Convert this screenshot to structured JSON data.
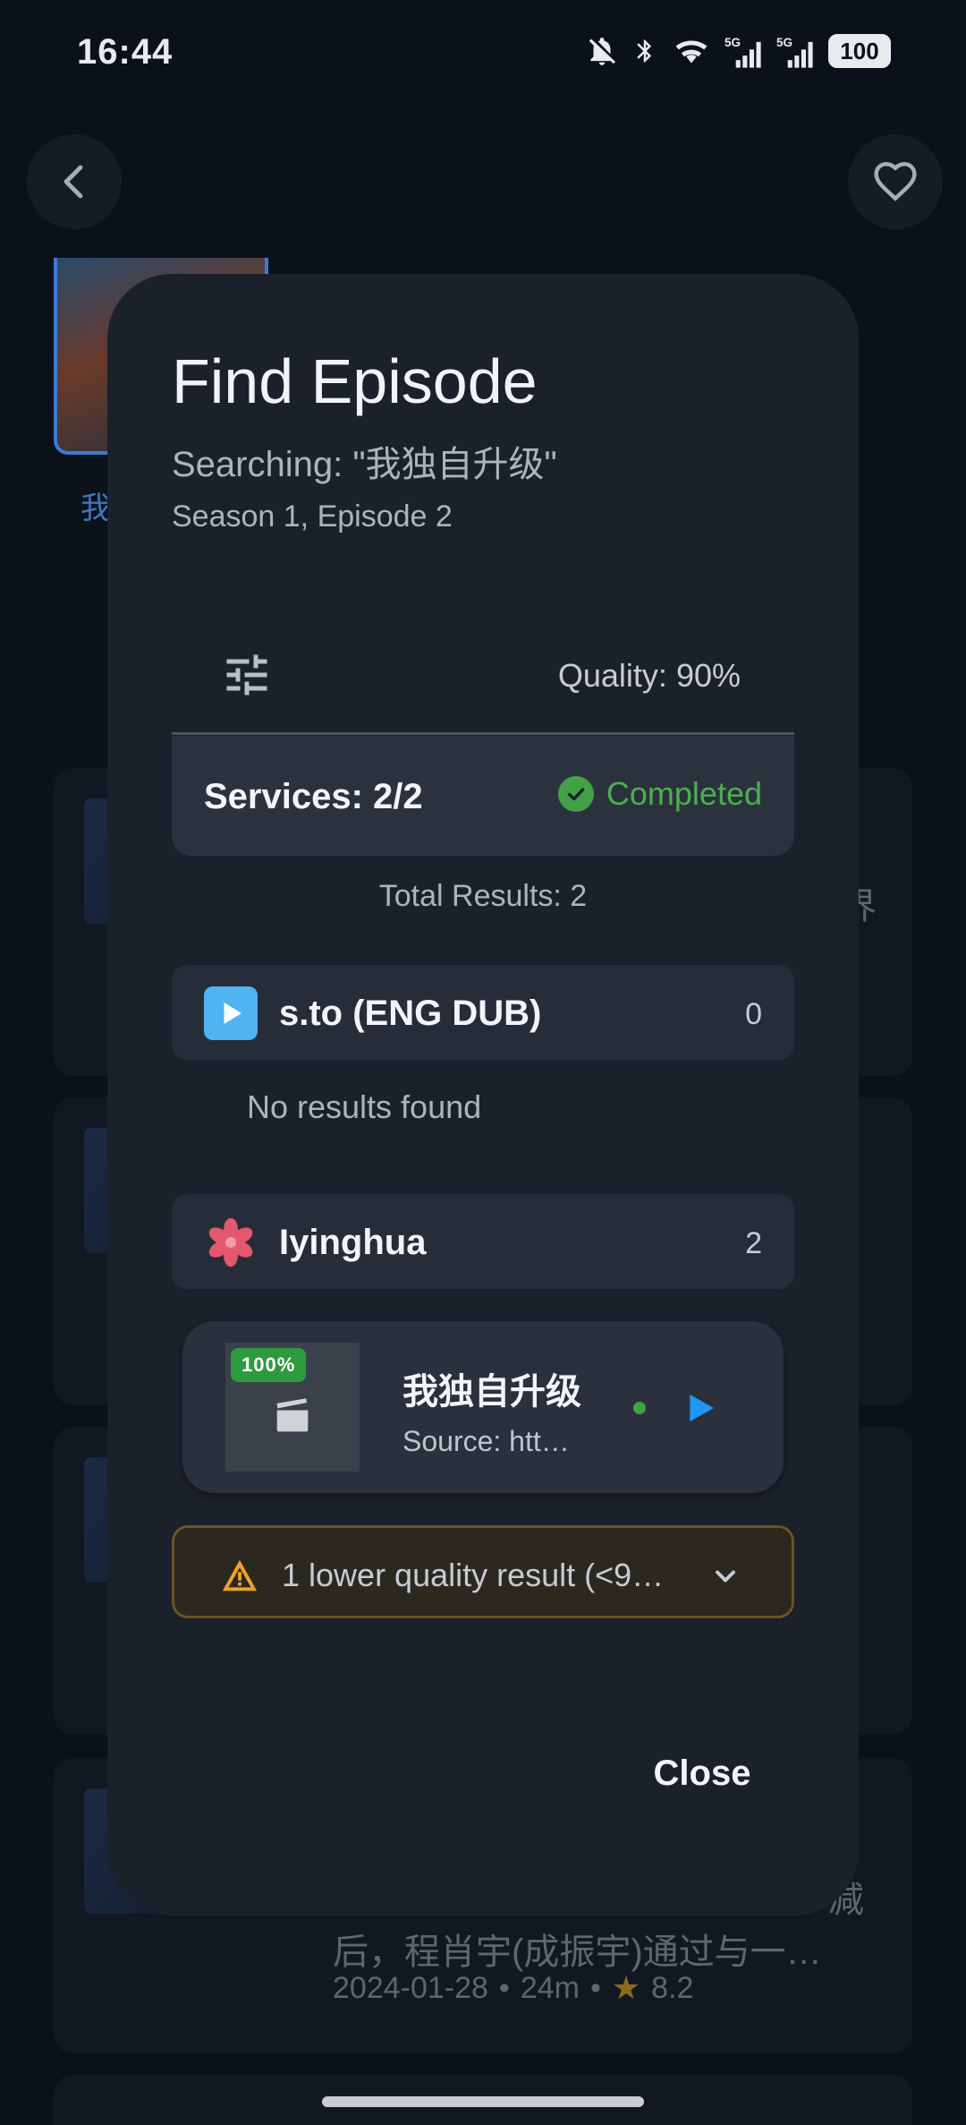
{
  "status_bar": {
    "time": "16:44",
    "battery": "100",
    "icons": [
      "bell-off-icon",
      "bluetooth-icon",
      "wifi-icon",
      "signal-5g-icon",
      "signal-5g-icon"
    ]
  },
  "background": {
    "back_icon": "chevron-left-icon",
    "favorite_icon": "heart-icon",
    "poster_caption": "我",
    "card_fragments": [
      "界",
      "减",
      "后，程肖宇(成振宇)通过与一…"
    ],
    "meta": {
      "date": "2024-01-28",
      "duration": "24m",
      "rating": "8.2"
    }
  },
  "dialog": {
    "title": "Find Episode",
    "searching": "Searching: \"我独自升级\"",
    "episode_info": "Season 1, Episode 2",
    "filter_icon": "tune-icon",
    "quality": "Quality: 90%",
    "services": {
      "label": "Services: 2/2",
      "status": "Completed"
    },
    "total_results": "Total Results: 2",
    "service_list": [
      {
        "name": "s.to (ENG DUB)",
        "count": "0",
        "icon": "play-icon",
        "empty_text": "No results found"
      },
      {
        "name": "Iyinghua",
        "count": "2",
        "icon": "flower-icon"
      }
    ],
    "result": {
      "badge": "100%",
      "title": "我独自升级",
      "source": "Source: htt…",
      "thumb_icon": "clapperboard-icon",
      "play_icon": "play-icon"
    },
    "lower_quality": {
      "text": "1 lower quality result (<9…",
      "icon": "warning-icon"
    },
    "close_label": "Close"
  },
  "colors": {
    "accent_green": "#43a047",
    "accent_blue": "#2196f3",
    "warning": "#f0a030",
    "dialog_bg": "#1b212b"
  }
}
